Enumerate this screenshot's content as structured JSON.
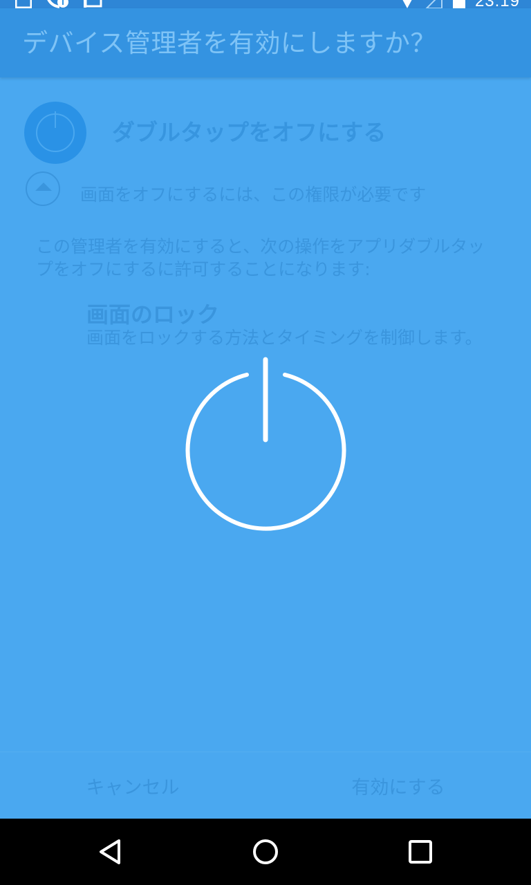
{
  "status_bar": {
    "time": "23:19",
    "left_icons": [
      "image-icon",
      "phone-info-icon",
      "photos-icon"
    ],
    "right_icons": [
      "wifi-icon",
      "signal-icon",
      "battery-icon"
    ]
  },
  "dialog": {
    "title": "デバイス管理者を有効にしますか？",
    "app_name": "ダブルタップをオフにする",
    "permission_reason": "画面をオフにするには、この権限が必要です",
    "description": "この管理者を有効にすると、次の操作をアプリダブルタップをオフにするに許可することになります:",
    "policies": [
      {
        "title": "画面のロック",
        "description": "画面をロックする方法とタイミングを制御します。"
      }
    ]
  },
  "buttons": {
    "cancel": "キャンセル",
    "activate": "有効にする"
  },
  "nav_bar": {
    "icons": [
      "back-icon",
      "home-icon",
      "recents-icon"
    ]
  },
  "colors": {
    "background": "#4AA8F0",
    "title_bar": "#3493E1",
    "status_bar": "#2E86D6",
    "muted_text": "#3A95DD",
    "overlay_icon": "#FFFFFF",
    "nav_bar": "#000000"
  }
}
